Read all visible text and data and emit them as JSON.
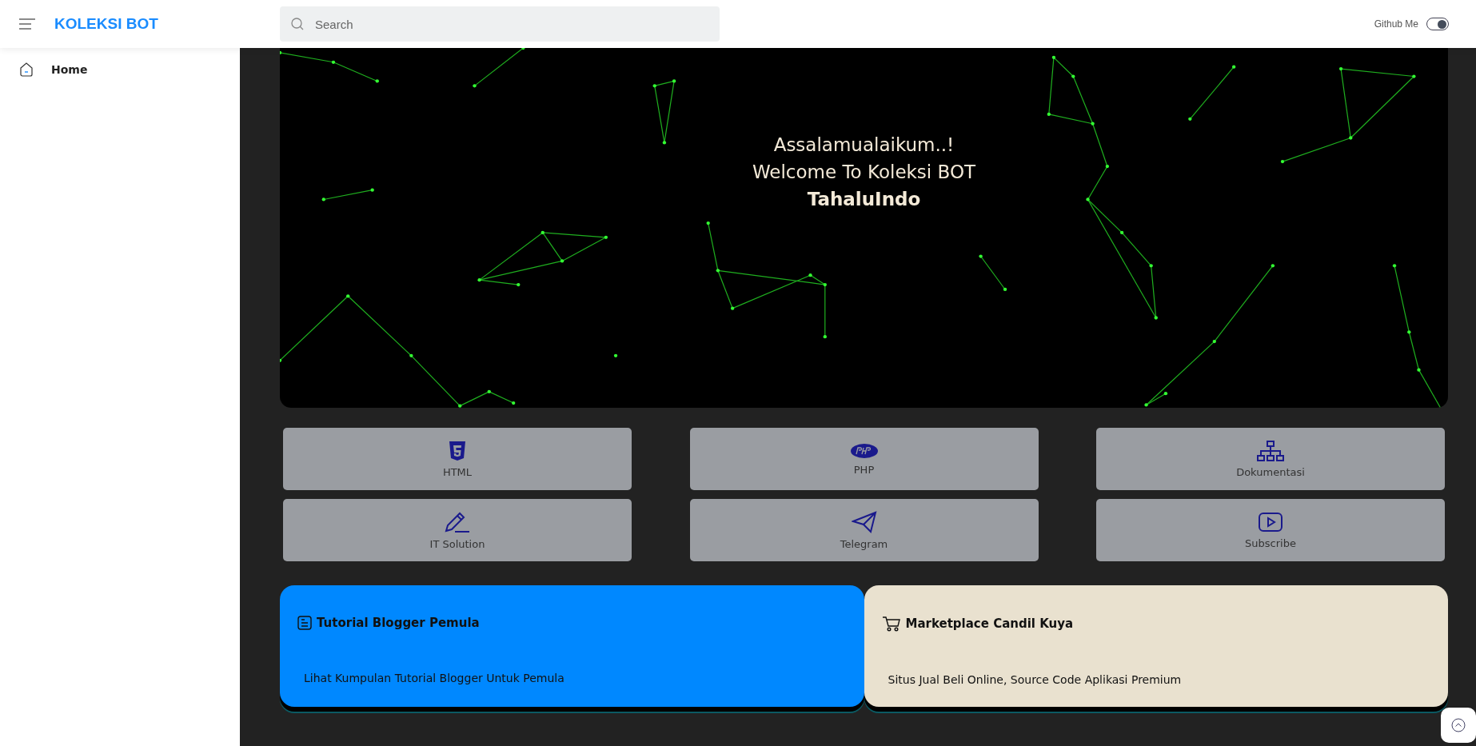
{
  "header": {
    "brand": "KOLEKSI BOT",
    "search": {
      "placeholder": "Search"
    },
    "github": {
      "label": "Github Me",
      "on": true
    }
  },
  "sidebar": {
    "items": [
      {
        "label": "Home",
        "selected": true
      }
    ]
  },
  "hero": {
    "lines": [
      "Assalamualaikum..!",
      "Welcome To Koleksi BOT",
      "TahaluIndo"
    ]
  },
  "shortcuts": [
    {
      "label": "HTML",
      "kind": "html"
    },
    {
      "label": "PHP",
      "kind": "php"
    },
    {
      "label": "Dokumentasi",
      "kind": "sitemap"
    },
    {
      "label": "IT Solution",
      "kind": "pencil"
    },
    {
      "label": "Telegram",
      "kind": "telegram"
    },
    {
      "label": "Subscribe",
      "kind": "youtube"
    }
  ],
  "cards": [
    {
      "title": "Tutorial Blogger Pemula",
      "text": "Lihat Kumpulan Tutorial Blogger Untuk Pemula",
      "kind": "blogger",
      "color": "#0088ff"
    },
    {
      "title": "Marketplace Candil Kuya",
      "text": "Situs Jual Beli Online, Source Code Aplikasi Premium",
      "kind": "cart",
      "color": "#e9e1cf"
    }
  ]
}
